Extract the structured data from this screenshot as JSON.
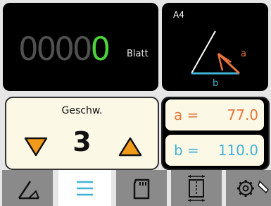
{
  "counter": {
    "digits_dim": "0000",
    "digits_lit": "0",
    "unit": "Blatt"
  },
  "format": {
    "label": "A4",
    "side_a": "a",
    "side_b": "b"
  },
  "speed": {
    "label": "Geschw.",
    "value": "3"
  },
  "dimensions": {
    "a_label": "a =",
    "a_value": "77.0",
    "b_label": "b =",
    "b_value": "110.0"
  },
  "tabs": [
    "fold-angle-icon",
    "list-icon",
    "sd-card-icon",
    "paper-size-icon",
    "settings-icon"
  ],
  "colors": {
    "counter_lit": "#4ad33b",
    "accent_orange": "#e8743b",
    "accent_blue": "#3fb3d6",
    "panel_cream": "#fcf8e6",
    "tab_active": "#ffffff",
    "tab_inactive": "#8a8a8a"
  }
}
